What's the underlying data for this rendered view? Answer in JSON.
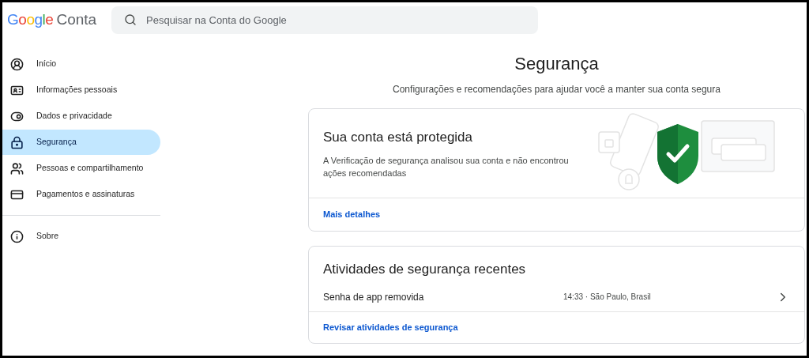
{
  "header": {
    "logo": "Google",
    "product": "Conta",
    "search": {
      "placeholder": "Pesquisar na Conta do Google"
    }
  },
  "sidebar": {
    "items": [
      {
        "label": "Início",
        "selected": false
      },
      {
        "label": "Informações pessoais",
        "selected": false
      },
      {
        "label": "Dados e privacidade",
        "selected": false
      },
      {
        "label": "Segurança",
        "selected": true
      },
      {
        "label": "Pessoas e compartilhamento",
        "selected": false
      },
      {
        "label": "Pagamentos e assinaturas",
        "selected": false
      }
    ],
    "footer_items": [
      {
        "label": "Sobre",
        "selected": false
      }
    ]
  },
  "main": {
    "title": "Segurança",
    "subtitle": "Configurações e recomendações para ajudar você a manter sua conta segura",
    "status_card": {
      "title": "Sua conta está protegida",
      "description": "A Verificação de segurança analisou sua conta e não encontrou ações recomendadas",
      "link": "Mais detalhes"
    },
    "activity_card": {
      "title": "Atividades de segurança recentes",
      "events": [
        {
          "name": "Senha de app removida",
          "detail": "14:33 · São Paulo, Brasil"
        }
      ],
      "link": "Revisar atividades de segurança"
    }
  }
}
